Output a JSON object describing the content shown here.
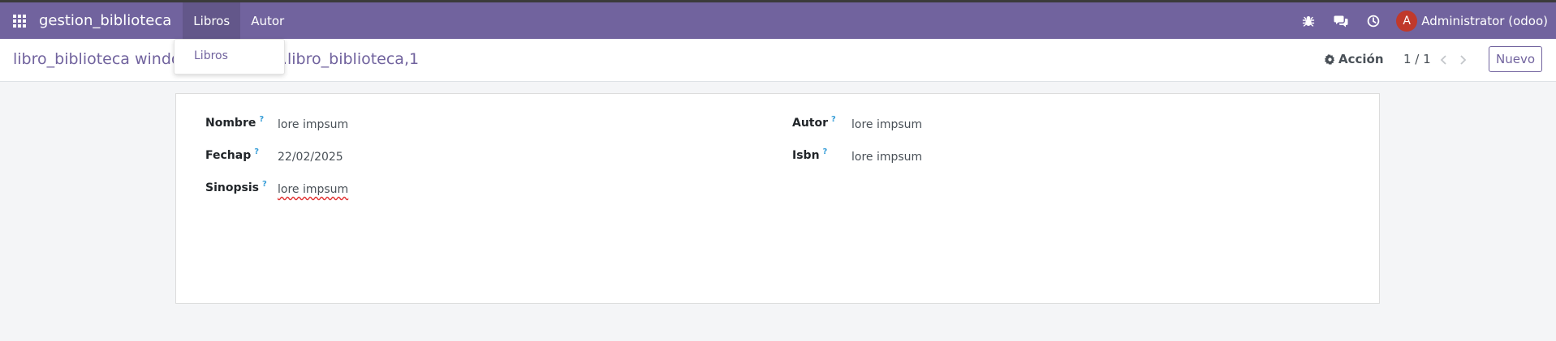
{
  "navbar": {
    "app_name": "gestion_biblioteca",
    "menus": [
      {
        "label": "Libros"
      },
      {
        "label": "Autor"
      }
    ],
    "user": {
      "avatar_initial": "A",
      "name": "Administrator (odoo)"
    },
    "icons": [
      "apps-grid-icon",
      "bug-icon",
      "chat-icon",
      "clock-icon"
    ],
    "colors": {
      "navbar": "#71639e",
      "avatar": "#c0392b"
    }
  },
  "dropdown": {
    "items": [
      {
        "label": "Libros"
      }
    ]
  },
  "control_panel": {
    "breadcrumb_visible_left": "libro_biblioteca windo",
    "breadcrumb_visible_right": "lioteca.libro_biblioteca,1",
    "actions_label": "Acción",
    "pager": "1 / 1",
    "new_button": "Nuevo"
  },
  "form": {
    "fields": {
      "nombre": {
        "label": "Nombre",
        "help": "?",
        "value": "lore impsum"
      },
      "fechap": {
        "label": "Fechap",
        "help": "?",
        "value": "22/02/2025"
      },
      "sinopsis": {
        "label": "Sinopsis",
        "help": "?",
        "value": "lore impsum"
      },
      "autor": {
        "label": "Autor",
        "help": "?",
        "value": "lore impsum"
      },
      "isbn": {
        "label": "Isbn",
        "help": "?",
        "value": "lore impsum"
      }
    }
  }
}
